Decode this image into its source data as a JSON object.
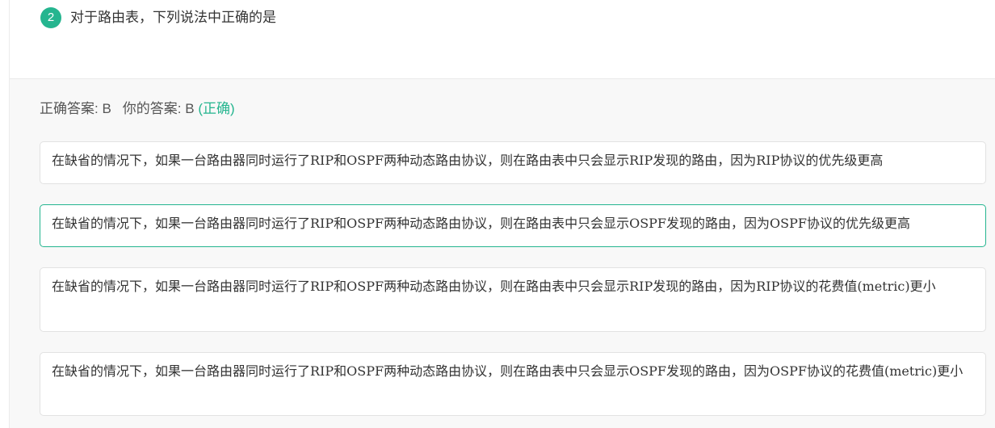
{
  "question": {
    "number": "2",
    "title": "对于路由表，下列说法中正确的是"
  },
  "answer": {
    "correct_label": "正确答案: B",
    "yours_label": "你的答案: B",
    "status": "(正确)"
  },
  "options": [
    {
      "text": "在缺省的情况下，如果一台路由器同时运行了RIP和OSPF两种动态路由协议，则在路由表中只会显示RIP发现的路由，因为RIP协议的优先级更高",
      "selected": false
    },
    {
      "text": "在缺省的情况下，如果一台路由器同时运行了RIP和OSPF两种动态路由协议，则在路由表中只会显示OSPF发现的路由，因为OSPF协议的优先级更高",
      "selected": true
    },
    {
      "text": "在缺省的情况下，如果一台路由器同时运行了RIP和OSPF两种动态路由协议，则在路由表中只会显示RIP发现的路由，因为RIP协议的花费值(metric)更小",
      "selected": false
    },
    {
      "text": "在缺省的情况下，如果一台路由器同时运行了RIP和OSPF两种动态路由协议，则在路由表中只会显示OSPF发现的路由，因为OSPF协议的花费值(metric)更小",
      "selected": false
    }
  ],
  "colors": {
    "accent": "#25b58f",
    "panel_bg": "#f8f8f8",
    "text": "#333333"
  }
}
